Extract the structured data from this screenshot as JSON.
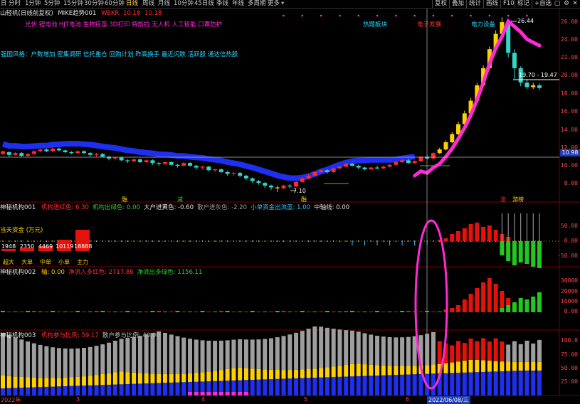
{
  "toolbar": {
    "lead": "日",
    "periods": [
      "分时",
      "1分钟",
      "5分钟",
      "15分钟",
      "30分钟",
      "60分钟",
      "日线",
      "周线",
      "月线",
      "10分钟",
      "45日线",
      "季线",
      "年线",
      "多周期",
      "更多"
    ],
    "selected_period": "日线",
    "buttons": [
      "复权",
      "叠加",
      "统计",
      "画线",
      "F10",
      "标记",
      "+自选"
    ]
  },
  "main_chart": {
    "title": "山轻机(日线前复权)",
    "indicator_name": "MIKE趋势001",
    "indicator_value_label": "WEKR",
    "indicator_v1": "10.18",
    "indicator_v2": "10.18",
    "concepts_line": "光伏 锂电池 HJT电池 生物疫苗 3D打印 特斯拉 无人机 人工智能 口罩防护",
    "style_line": "强国风格：户数增加 密集调研 信托重仓 回购计划 昨高换手 最近闪跌 活跃股 通达信热股",
    "concept_badges": [
      "热题板块",
      "电子发展",
      "电力设备"
    ],
    "y_ticks": [
      "26.00",
      "24.00",
      "22.00",
      "20.00",
      "18.00",
      "16.00",
      "14.00",
      "12.00",
      "10.00",
      "8.00"
    ],
    "current_price": "10.98",
    "high_label": "26.44",
    "low_label": "7.10",
    "range_label": "19.70 - 19.47",
    "markers": [
      "融",
      "减",
      "融",
      "涨",
      "游榜"
    ]
  },
  "pane1": {
    "name": "神秘机构001",
    "items": [
      {
        "label": "机构进红色",
        "value": "6.30",
        "color": "#ff3030"
      },
      {
        "label": "机构出绿色",
        "value": "0.00",
        "color": "#2ad02a"
      },
      {
        "label": "大户进黄色",
        "value": "-0.60",
        "color": "#e0e0e0"
      },
      {
        "label": "散户进灰色",
        "value": "-2.20",
        "color": "#9a9a9a"
      },
      {
        "label": "小单资金出流蓝",
        "value": "1.00",
        "color": "#2ac8ff"
      },
      {
        "label": "中轴线",
        "value": "0.00",
        "color": "#e0e0e0"
      }
    ],
    "y_ticks": [
      "50.00",
      "0.00",
      "-50.00"
    ],
    "left_panel": {
      "title": "当天资金 (万元)",
      "values": [
        "1948",
        "2350",
        "4469",
        "10119",
        "18888"
      ],
      "heights": [
        0.1,
        0.12,
        0.24,
        0.54,
        1.0
      ],
      "categories": [
        "超大",
        "大单",
        "中单",
        "小单",
        "主力"
      ]
    }
  },
  "pane2": {
    "name": "神秘机构002",
    "items": [
      {
        "label": "轴",
        "value": "0.00",
        "color": "#ffd000"
      },
      {
        "label": "净流入多红色",
        "value": "2717.86",
        "color": "#ff3030"
      },
      {
        "label": "净流出多绿色",
        "value": "1156.11",
        "color": "#2ad02a"
      }
    ],
    "y_ticks": [
      "30000",
      "20000",
      "10000",
      "0.00"
    ]
  },
  "pane3": {
    "name": "神秘机构003",
    "items": [
      {
        "label": "机构参与比例",
        "value": "59.17",
        "color": "#ff3030"
      },
      {
        "label": "散户参与比例",
        "value": "40.00",
        "color": "#bdbdbd"
      }
    ],
    "y_ticks": [
      "100.0",
      "75.00",
      "50.00",
      "25.00"
    ]
  },
  "x_axis": {
    "labels": [
      "2022年",
      "3",
      "4",
      "5",
      "6"
    ],
    "cursor_date": "2022/06/08/三"
  },
  "colors": {
    "up": "#ff2a2a",
    "down": "#33d6c6",
    "boll": "#1f2ff0",
    "trend": "#ff2ad4",
    "yellow": "#ffd000"
  },
  "candles": [
    [
      11.3,
      11.6,
      11.2,
      11.7
    ],
    [
      11.5,
      11.2,
      11.0,
      11.6
    ],
    [
      11.2,
      11.4,
      11.1,
      11.5
    ],
    [
      11.4,
      11.1,
      11.0,
      11.5
    ],
    [
      11.1,
      11.3,
      11.0,
      11.4
    ],
    [
      11.3,
      11.6,
      11.2,
      11.7
    ],
    [
      11.6,
      11.8,
      11.5,
      11.9
    ],
    [
      11.8,
      11.6,
      11.5,
      11.9
    ],
    [
      11.6,
      11.9,
      11.5,
      12.0
    ],
    [
      11.9,
      11.7,
      11.6,
      12.0
    ],
    [
      11.7,
      11.5,
      11.4,
      11.8
    ],
    [
      11.5,
      11.4,
      11.3,
      11.6
    ],
    [
      11.4,
      11.6,
      11.3,
      11.7
    ],
    [
      11.6,
      11.4,
      11.3,
      11.7
    ],
    [
      11.4,
      11.2,
      11.0,
      11.5
    ],
    [
      11.2,
      11.3,
      11.0,
      11.4
    ],
    [
      11.3,
      11.0,
      10.9,
      11.4
    ],
    [
      11.0,
      10.8,
      10.6,
      11.1
    ],
    [
      10.8,
      10.9,
      10.6,
      11.0
    ],
    [
      10.9,
      10.6,
      10.5,
      11.0
    ],
    [
      10.6,
      10.5,
      10.3,
      10.7
    ],
    [
      10.5,
      10.7,
      10.4,
      10.8
    ],
    [
      10.7,
      10.4,
      10.3,
      10.8
    ],
    [
      10.4,
      10.6,
      10.3,
      10.7
    ],
    [
      10.6,
      10.3,
      10.1,
      10.7
    ],
    [
      10.3,
      10.2,
      10.0,
      10.4
    ],
    [
      10.2,
      10.4,
      10.1,
      10.5
    ],
    [
      10.4,
      10.1,
      10.0,
      10.5
    ],
    [
      10.1,
      10.0,
      9.8,
      10.2
    ],
    [
      10.0,
      10.3,
      9.9,
      10.4
    ],
    [
      10.3,
      10.0,
      9.9,
      10.4
    ],
    [
      10.0,
      9.8,
      9.6,
      10.1
    ],
    [
      9.8,
      9.9,
      9.6,
      10.0
    ],
    [
      9.9,
      9.5,
      9.4,
      10.0
    ],
    [
      9.5,
      9.6,
      9.3,
      9.7
    ],
    [
      9.6,
      9.3,
      9.2,
      9.7
    ],
    [
      9.3,
      9.1,
      8.9,
      9.4
    ],
    [
      9.1,
      9.2,
      8.9,
      9.3
    ],
    [
      9.2,
      8.9,
      8.7,
      9.3
    ],
    [
      8.9,
      8.6,
      8.4,
      9.0
    ],
    [
      8.6,
      8.3,
      8.1,
      8.7
    ],
    [
      8.3,
      8.1,
      7.9,
      8.4
    ],
    [
      8.1,
      7.8,
      7.5,
      8.2
    ],
    [
      7.8,
      7.6,
      7.3,
      7.9
    ],
    [
      7.6,
      7.5,
      7.1,
      7.8
    ],
    [
      7.5,
      7.8,
      7.4,
      7.9
    ],
    [
      7.8,
      7.7,
      7.5,
      8.0
    ],
    [
      7.7,
      8.2,
      7.6,
      8.3
    ],
    [
      8.2,
      8.6,
      8.1,
      8.7
    ],
    [
      8.6,
      8.9,
      8.5,
      9.1
    ],
    [
      8.9,
      9.3,
      8.8,
      9.4
    ],
    [
      9.3,
      9.5,
      9.2,
      9.6
    ],
    [
      9.5,
      9.3,
      9.1,
      9.6
    ],
    [
      9.3,
      9.7,
      9.2,
      9.8
    ],
    [
      9.7,
      9.9,
      9.6,
      10.0
    ],
    [
      9.9,
      10.2,
      9.8,
      10.3
    ],
    [
      10.2,
      10.0,
      9.9,
      10.3
    ],
    [
      10.0,
      9.8,
      9.6,
      10.1
    ],
    [
      9.8,
      9.6,
      9.5,
      9.9
    ],
    [
      9.6,
      9.8,
      9.5,
      9.9
    ],
    [
      9.8,
      9.7,
      9.6,
      10.0
    ],
    [
      9.7,
      9.9,
      9.6,
      10.0
    ],
    [
      9.9,
      10.1,
      9.8,
      10.2
    ],
    [
      10.1,
      10.4,
      10.0,
      10.5
    ],
    [
      10.4,
      10.6,
      10.3,
      10.7
    ],
    [
      10.6,
      10.3,
      10.2,
      10.8
    ],
    [
      10.3,
      10.5,
      10.2,
      10.6
    ],
    [
      10.5,
      11.0,
      10.4,
      11.1
    ],
    [
      11.0,
      10.8,
      10.7,
      11.2
    ],
    [
      10.8,
      11.4,
      10.7,
      11.5
    ],
    [
      11.4,
      11.8,
      11.3,
      12.0
    ],
    [
      11.8,
      12.6,
      11.7,
      12.8
    ],
    [
      12.6,
      13.5,
      12.5,
      13.7
    ],
    [
      13.5,
      14.6,
      13.4,
      14.9
    ],
    [
      14.6,
      15.8,
      14.5,
      16.1
    ],
    [
      15.8,
      17.2,
      15.6,
      17.5
    ],
    [
      17.2,
      18.9,
      17.0,
      19.2
    ],
    [
      18.9,
      20.8,
      18.7,
      21.1
    ],
    [
      20.8,
      22.9,
      20.6,
      23.2
    ],
    [
      22.9,
      24.6,
      22.7,
      25.0
    ],
    [
      24.6,
      25.9,
      24.2,
      26.44
    ],
    [
      25.9,
      22.5,
      22.0,
      26.1
    ],
    [
      22.5,
      20.8,
      19.6,
      22.9
    ],
    [
      20.8,
      19.2,
      18.8,
      21.0
    ],
    [
      19.2,
      18.7,
      18.5,
      19.5
    ],
    [
      18.7,
      18.9,
      18.5,
      19.2
    ],
    [
      18.9,
      18.6,
      18.4,
      19.1
    ]
  ]
}
